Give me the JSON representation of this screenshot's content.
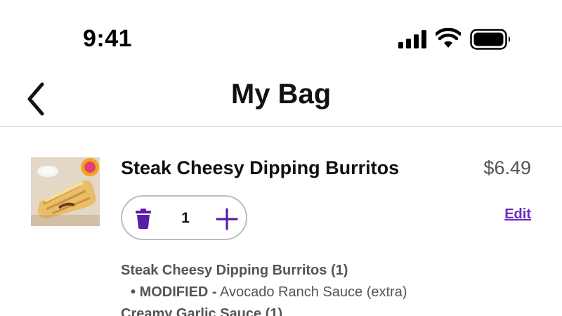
{
  "status_bar": {
    "time": "9:41",
    "icons": [
      "signal-icon",
      "wifi-icon",
      "battery-icon"
    ]
  },
  "header": {
    "title": "My Bag",
    "back_icon": "chevron-left-icon"
  },
  "item": {
    "name": "Steak Cheesy Dipping Burritos",
    "price": "$6.49",
    "quantity": "1",
    "edit_label": "Edit",
    "image_icon": "food-photo"
  },
  "details": {
    "line1": "Steak Cheesy Dipping Burritos (1)",
    "bullet": "•",
    "modifier_label": "MODIFIED -",
    "modifier_value": "Avocado Ranch Sauce (extra)",
    "line3": "Creamy Garlic Sauce (1)"
  },
  "colors": {
    "accent": "#5b1ca8",
    "text_primary": "#111111",
    "text_secondary": "#555555",
    "divider": "#d6d6d6"
  }
}
